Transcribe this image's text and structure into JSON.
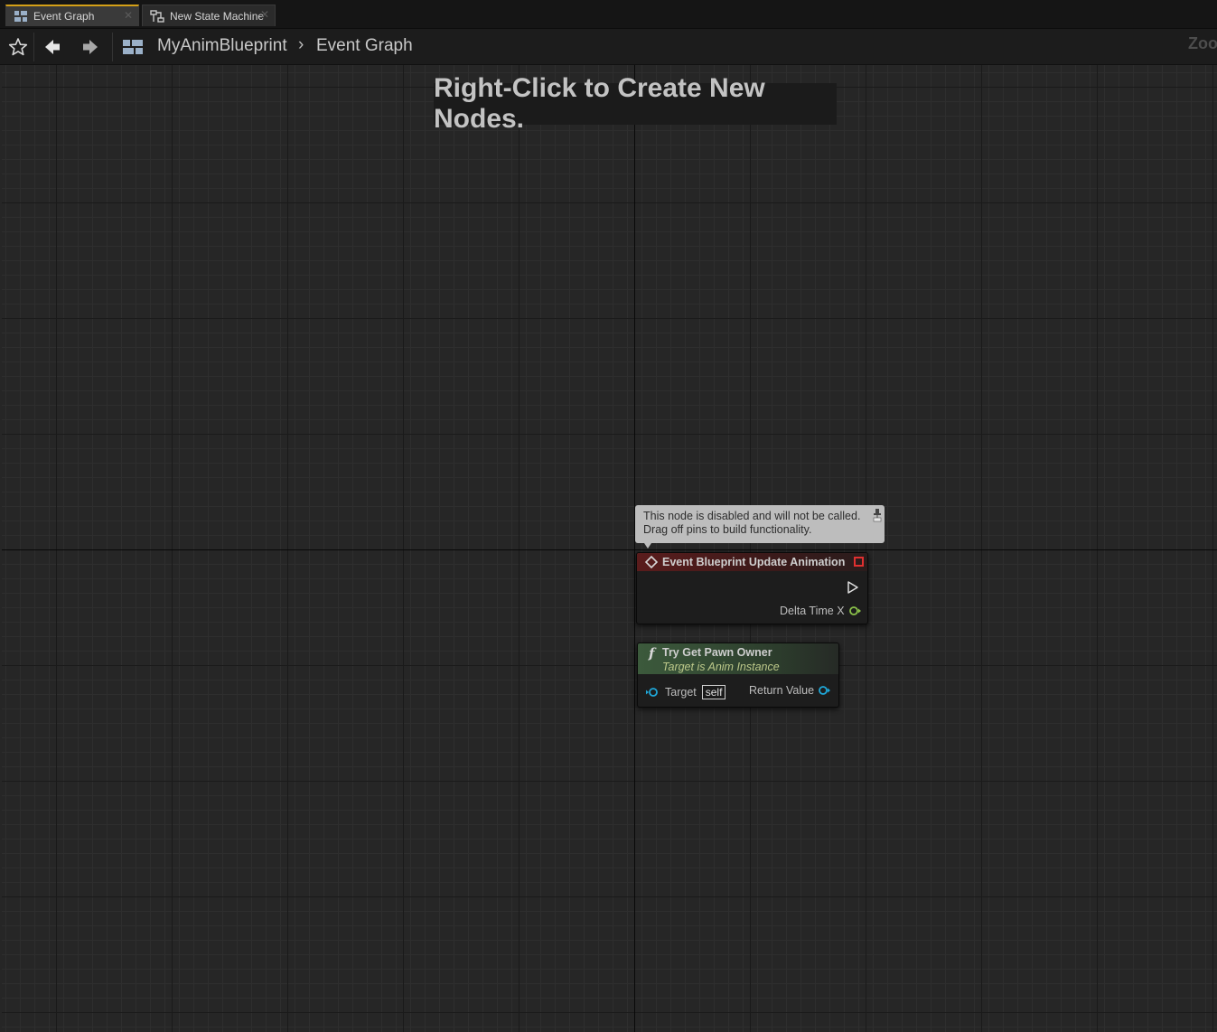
{
  "tabs": [
    {
      "label": "Event Graph",
      "active": true
    },
    {
      "label": "New State Machine",
      "active": false
    }
  ],
  "breadcrumb": {
    "blueprint": "MyAnimBlueprint",
    "graph": "Event Graph"
  },
  "zoom_label": "Zoom",
  "graph": {
    "hint": "Right-Click to Create New Nodes.",
    "comment_line1": "This node is disabled and will not be called.",
    "comment_line2": "Drag off pins to build functionality.",
    "event_node": {
      "title": "Event Blueprint Update Animation",
      "pin_delta": "Delta Time X"
    },
    "func_node": {
      "title": "Try Get Pawn Owner",
      "subtitle": "Target is Anim Instance",
      "pin_target": "Target",
      "pin_target_default": "self",
      "pin_return": "Return Value"
    }
  },
  "colors": {
    "tab_active_accent": "#d4a017",
    "event_header": "#5a1c1c",
    "function_header": "#3c5a3c",
    "exec_pin": "#e0e0e0",
    "float_pin": "#8bc24a",
    "object_pin": "#1fa7d8",
    "event_error_square": "#e03030"
  }
}
